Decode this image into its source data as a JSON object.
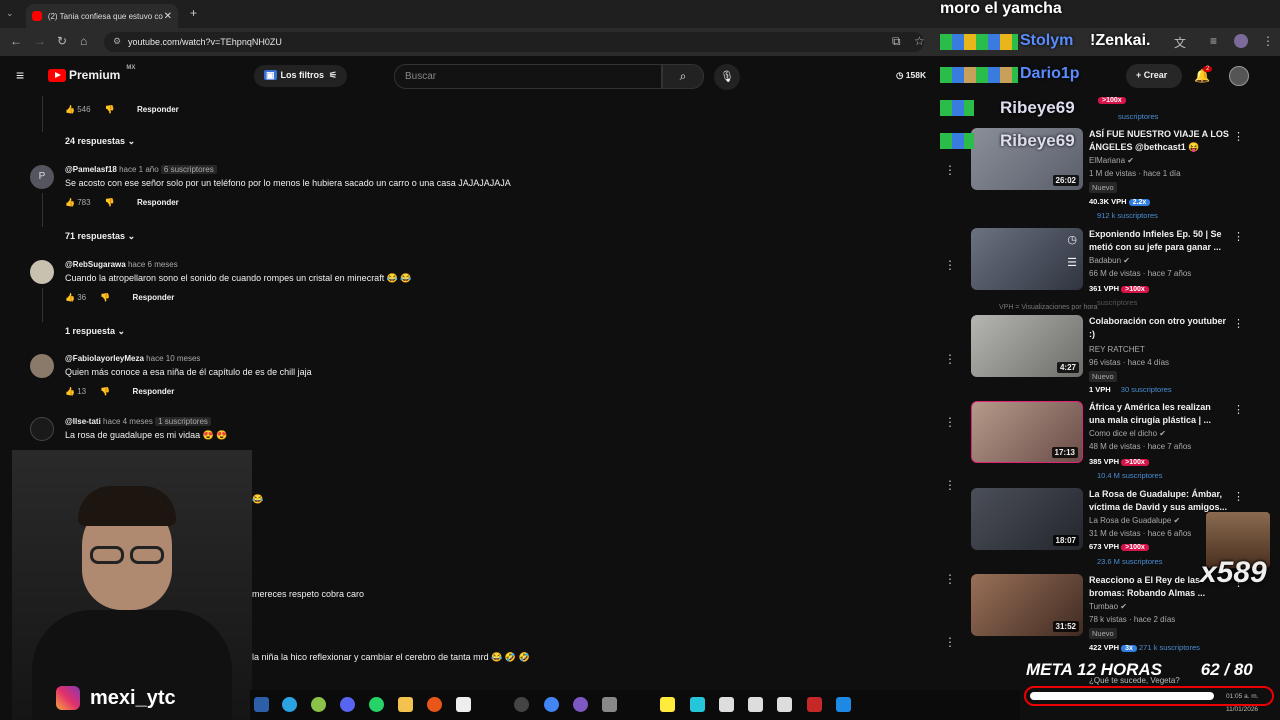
{
  "browser": {
    "tab_title": "(2) Tania confiesa que estuvo co",
    "tab_close": "✕",
    "new_tab": "+",
    "url": "youtube.com/watch?v=TEhpnqNH0ZU"
  },
  "stream_overlay": {
    "top_name": "moro el yamcha",
    "names": [
      "Stolym",
      "!Zenkai.",
      "Dario1p",
      "Ribeye69",
      "Ribeye69"
    ],
    "meta_label": "META 12 HORAS",
    "meta_count": "62 / 80",
    "meta_progress": 0.775,
    "multiplier": "x589",
    "instagram": "mexi_ytc",
    "clock_time": "01:05 a. m.",
    "clock_date": "11/01/2026"
  },
  "youtube": {
    "brand": "Premium",
    "region": "MX",
    "filters_label": "Los filtros",
    "search_placeholder": "Buscar",
    "live_count": "158K",
    "create_label": "Crear",
    "notif_count": "2"
  },
  "comments": {
    "top": {
      "likes": "546",
      "reply": "Responder"
    },
    "replies_a": "24 respuestas",
    "items": [
      {
        "initial": "P",
        "user": "@Pamelasf18",
        "time": "hace 1 año",
        "badge": "6 suscriptores",
        "text": "Se acosto con ese señor solo por un teléfono por lo menos le hubiera sacado un carro o una casa JAJAJAJAJA",
        "likes": "783",
        "reply": "Responder",
        "replies": "71 respuestas"
      },
      {
        "initial": "",
        "user": "@RebSugarawa",
        "time": "hace 6 meses",
        "badge": "",
        "text": "Cuando la atropellaron sono el sonido de cuando rompes un cristal en minecraft 😂 😂",
        "likes": "36",
        "reply": "Responder",
        "replies": "1 respuesta"
      },
      {
        "initial": "",
        "user": "@FabiolayorleyMeza",
        "time": "hace 10 meses",
        "badge": "",
        "text": "Quien más conoce a esa niña de él capítulo de es de chill jaja",
        "likes": "13",
        "reply": "Responder",
        "replies": ""
      },
      {
        "initial": "",
        "user": "@Ilse-tati",
        "time": "hace 4 meses",
        "badge": "1 suscriptores",
        "text": "La rosa de guadalupe es mi vidaa 😍 😍",
        "likes": "",
        "reply": "",
        "replies": ""
      }
    ],
    "partial_1": "😂",
    "partial_2": "mereces respeto cobra caro",
    "partial_3": "la niña la hico reflexionar y cambiar el cerebro de tanta mrd 😂 🤣 🤣"
  },
  "sidebar": {
    "top_vph": ">100x",
    "top_subs": "suscriptores",
    "videos": [
      {
        "title": "ASÍ FUE NUESTRO VIAJE A LOS ÁNGELES @bethcast1 😝",
        "channel": "ElMariana",
        "stats": "1 M de vistas · hace 1 día",
        "nuevo": "Nuevo",
        "duration": "26:02",
        "vph": "40.3K VPH",
        "mult": "2.2x",
        "mult_color": "blue",
        "subs": "912 k suscriptores",
        "thumb": "#6a6e7a"
      },
      {
        "title": "Exponiendo Infieles Ep. 50 | Se metió con su jefe para ganar ...",
        "channel": "Badabun",
        "stats": "66 M de vistas · hace 7 años",
        "nuevo": "",
        "duration": "",
        "vph": "361 VPH",
        "mult": ">100x",
        "mult_color": "red",
        "subs": "suscriptores",
        "thumb": "#4b5563"
      },
      {
        "title": "Colaboración con otro youtuber :)",
        "channel": "REY RATCHET",
        "stats": "96 vistas · hace 4 días",
        "nuevo": "Nuevo",
        "duration": "4:27",
        "vph": "1 VPH",
        "mult": "",
        "mult_color": "",
        "subs": "30 suscriptores",
        "thumb": "#9a9a98"
      },
      {
        "title": "África y América les realizan una mala cirugía plástica | ...",
        "channel": "Como dice el dicho",
        "stats": "48 M de vistas · hace 7 años",
        "nuevo": "",
        "duration": "17:13",
        "vph": "385 VPH",
        "mult": ">100x",
        "mult_color": "red",
        "subs": "10.4 M suscriptores",
        "thumb": "#8d6d6a"
      },
      {
        "title": "La Rosa de Guadalupe: Ámbar, víctima de David y sus amigos...",
        "channel": "La Rosa de Guadalupe",
        "stats": "31 M de vistas · hace 6 años",
        "nuevo": "",
        "duration": "18:07",
        "vph": "673 VPH",
        "mult": ">100x",
        "mult_color": "red",
        "subs": "23.6 M suscriptores",
        "thumb": "#3c3f48"
      },
      {
        "title": "Reacciono a El Rey de las bromas: Robando Almas ...",
        "channel": "Tumbao",
        "stats": "78 k vistas · hace 2 días",
        "nuevo": "Nuevo",
        "duration": "31:52",
        "vph": "422 VPH",
        "mult": "3x",
        "mult_color": "blue",
        "subs": "271 k suscriptores",
        "thumb": "#7a5a48"
      }
    ],
    "next_title": "¿Qué te sucede, Vegeta?",
    "vph_tooltip": "VPH = Visualizaciones por hora"
  },
  "colors": {
    "accent_red": "#ff0000",
    "vph_red": "#d7144a",
    "vph_blue": "#2f7ee0",
    "subs_blue": "#4a8fd4"
  }
}
